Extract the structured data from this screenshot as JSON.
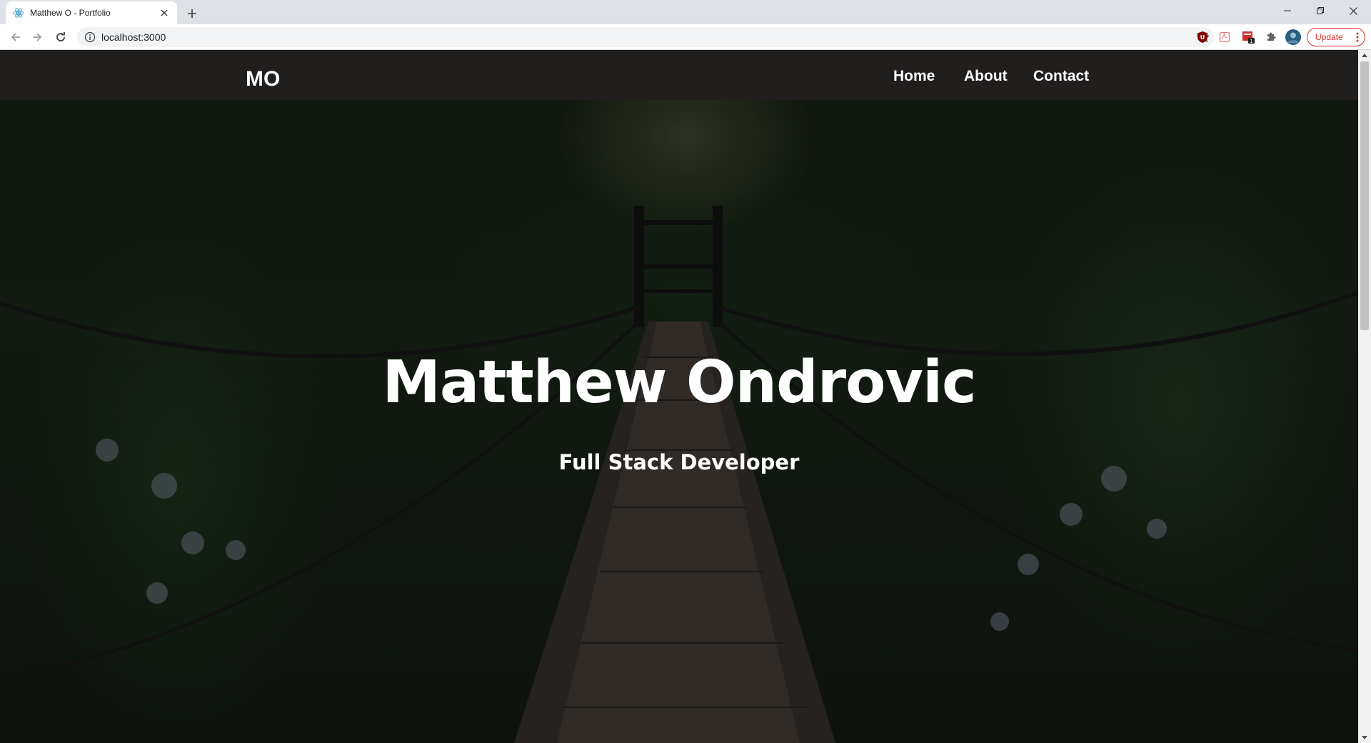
{
  "browser": {
    "tab_title": "Matthew O - Portfolio",
    "url": "localhost:3000",
    "update_label": "Update",
    "extension_badge": "1",
    "icons": [
      "react-favicon-icon",
      "close-icon",
      "plus-icon",
      "back-icon",
      "forward-icon",
      "reload-icon",
      "info-icon",
      "star-icon",
      "ublock-icon",
      "pdf-extension-icon",
      "calendar-extension-icon",
      "puzzle-icon",
      "avatar",
      "kebab-menu-icon",
      "minimize-icon",
      "restore-icon",
      "close-window-icon"
    ]
  },
  "site": {
    "logo": "MO",
    "nav": {
      "home": "Home",
      "about": "About",
      "contact": "Contact"
    },
    "hero": {
      "title": "Matthew Ondrovic",
      "subtitle": "Full Stack Developer"
    }
  },
  "colors": {
    "nav_bg": "#211e1e",
    "text": "#ffffff",
    "update_red": "#d93025"
  }
}
